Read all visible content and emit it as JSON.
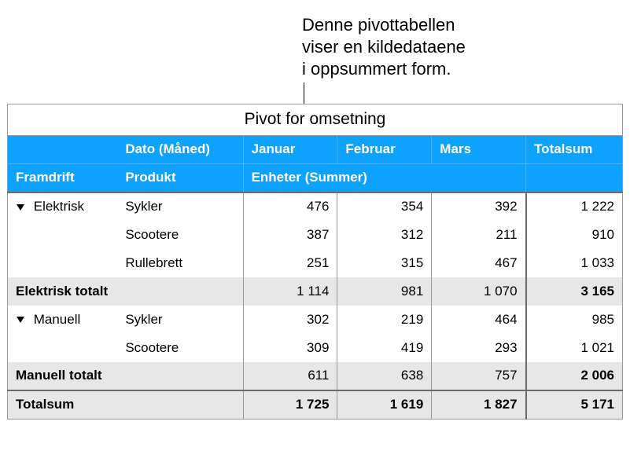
{
  "callout": {
    "line1": "Denne pivottabellen",
    "line2": "viser en kildedataene",
    "line3": "i oppsummert form."
  },
  "table": {
    "title": "Pivot for omsetning",
    "dateLabel": "Dato (Måned)",
    "months": {
      "jan": "Januar",
      "feb": "Februar",
      "mar": "Mars"
    },
    "totalLabel": "Totalsum",
    "rowFieldA": "Framdrift",
    "rowFieldB": "Produkt",
    "valueField": "Enheter (Summer)",
    "groups": [
      {
        "name": "Elektrisk",
        "subtotalLabel": "Elektrisk totalt",
        "rows": [
          {
            "product": "Sykler",
            "jan": "476",
            "feb": "354",
            "mar": "392",
            "tot": "1 222"
          },
          {
            "product": "Scootere",
            "jan": "387",
            "feb": "312",
            "mar": "211",
            "tot": "910"
          },
          {
            "product": "Rullebrett",
            "jan": "251",
            "feb": "315",
            "mar": "467",
            "tot": "1 033"
          }
        ],
        "subtotal": {
          "jan": "1 114",
          "feb": "981",
          "mar": "1 070",
          "tot": "3 165"
        }
      },
      {
        "name": "Manuell",
        "subtotalLabel": "Manuell totalt",
        "rows": [
          {
            "product": "Sykler",
            "jan": "302",
            "feb": "219",
            "mar": "464",
            "tot": "985"
          },
          {
            "product": "Scootere",
            "jan": "309",
            "feb": "419",
            "mar": "293",
            "tot": "1 021"
          }
        ],
        "subtotal": {
          "jan": "611",
          "feb": "638",
          "mar": "757",
          "tot": "2 006"
        }
      }
    ],
    "grand": {
      "label": "Totalsum",
      "jan": "1 725",
      "feb": "1 619",
      "mar": "1 827",
      "tot": "5 171"
    }
  }
}
